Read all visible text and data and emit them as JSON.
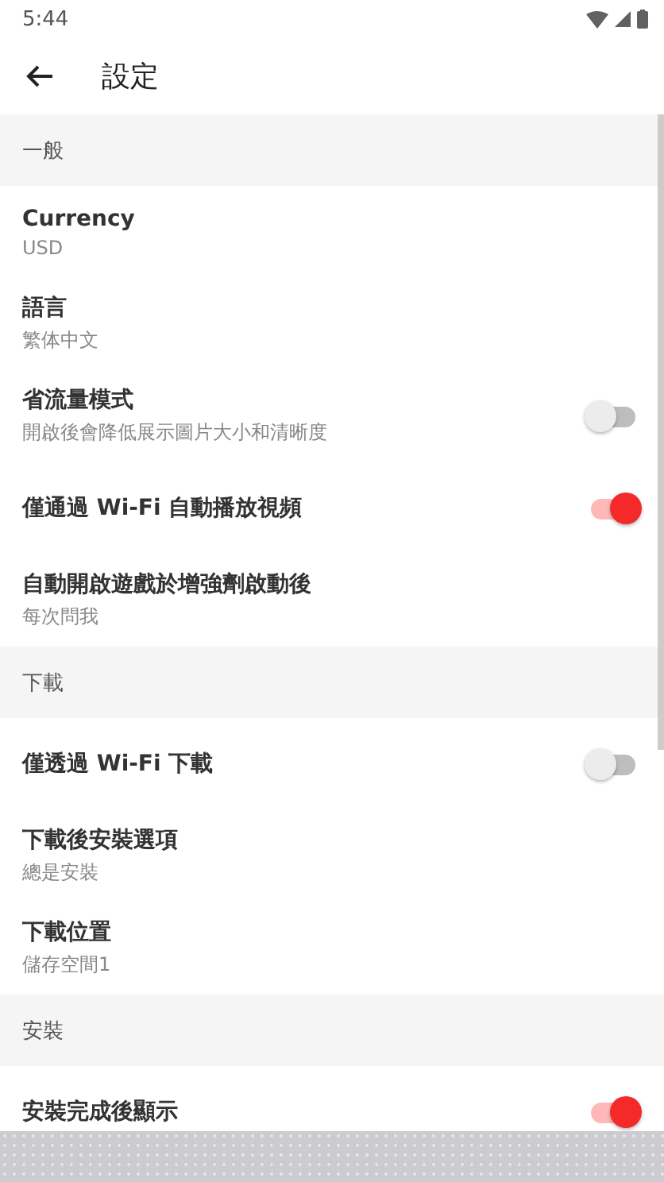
{
  "status_bar": {
    "time": "5:44"
  },
  "toolbar": {
    "title": "設定"
  },
  "sections": [
    {
      "header": "一般",
      "items": [
        {
          "kind": "text",
          "title": "Currency",
          "subtitle": "USD"
        },
        {
          "kind": "text",
          "title": "語言",
          "subtitle": "繁体中文"
        },
        {
          "kind": "switch",
          "title": "省流量模式",
          "subtitle": "開啟後會降低展示圖片大小和清晰度",
          "on": false
        },
        {
          "kind": "switch",
          "title": "僅通過 Wi-Fi 自動播放視頻",
          "on": true
        },
        {
          "kind": "text",
          "title": "自動開啟遊戲於增強劑啟動後",
          "subtitle": "每次問我"
        }
      ]
    },
    {
      "header": "下載",
      "items": [
        {
          "kind": "switch",
          "title": "僅透過 Wi-Fi 下載",
          "on": false
        },
        {
          "kind": "text",
          "title": "下載後安裝選項",
          "subtitle": "總是安裝"
        },
        {
          "kind": "text",
          "title": "下載位置",
          "subtitle": "儲存空間1"
        }
      ]
    },
    {
      "header": "安裝",
      "items": [
        {
          "kind": "switch",
          "title": "安裝完成後顯示",
          "on": true
        }
      ]
    }
  ]
}
